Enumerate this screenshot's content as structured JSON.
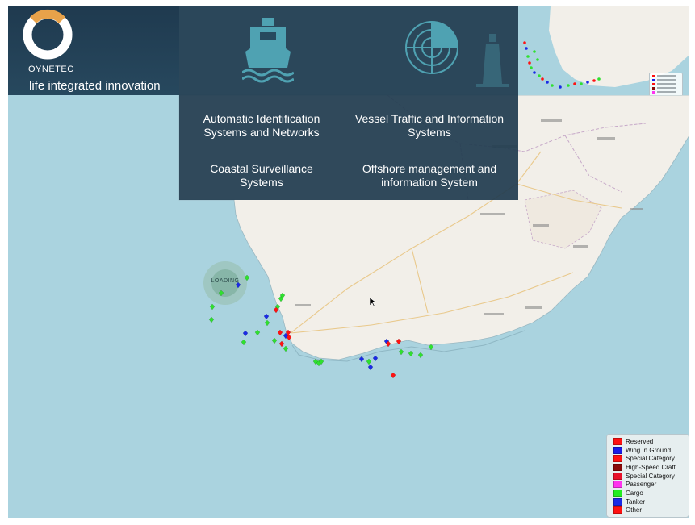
{
  "brand": {
    "logo_text": "OYNETEC",
    "tagline": "life integrated innovation",
    "ring_colors": {
      "accent": "#e8a24a",
      "main": "#ffffff"
    }
  },
  "services": [
    {
      "icon": "ship-icon",
      "label_line1": "Automatic Identification",
      "label_line2": "Systems and Networks"
    },
    {
      "icon": "radar-icon",
      "label_line1": "Vessel Traffic and Information",
      "label_line2": "Systems"
    },
    {
      "icon": "",
      "label_line1": "Coastal Surveillance",
      "label_line2": "Systems"
    },
    {
      "icon": "",
      "label_line1": "Offshore management and",
      "label_line2": "information System"
    }
  ],
  "loading": {
    "text": "LOADING"
  },
  "map": {
    "colors": {
      "sea": "#aad3df",
      "land": "#f2efe9",
      "border": "#c6a8c8",
      "road": "#e9c98c"
    }
  },
  "legend": {
    "items": [
      {
        "label": "Reserved",
        "color": "#ff1010"
      },
      {
        "label": "Wing In Ground",
        "color": "#1a1ae6"
      },
      {
        "label": "Special Category",
        "color": "#ff1010"
      },
      {
        "label": "High-Speed Craft",
        "color": "#8a0a0a"
      },
      {
        "label": "Special Category",
        "color": "#e8102a"
      },
      {
        "label": "Passenger",
        "color": "#ff33ee"
      },
      {
        "label": "Cargo",
        "color": "#22ee22"
      },
      {
        "label": "Tanker",
        "color": "#1a2ae6"
      },
      {
        "label": "Other",
        "color": "#ff1010"
      }
    ]
  },
  "vessels": {
    "cargo_color": "#2fe02f",
    "tanker_color": "#1a2ae6",
    "other_color": "#ff1212"
  }
}
